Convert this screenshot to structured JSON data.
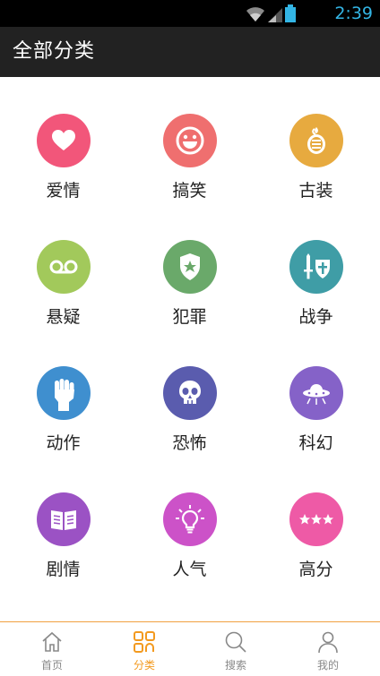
{
  "status_bar": {
    "time": "2:39",
    "wifi_icon": "wifi-icon",
    "signal_icon": "signal-icon",
    "battery_icon": "battery-icon"
  },
  "app_bar": {
    "title": "全部分类"
  },
  "categories": [
    {
      "label": "爱情",
      "icon": "heart-icon",
      "color": "#f2567a"
    },
    {
      "label": "搞笑",
      "icon": "laughing-face-icon",
      "color": "#ef6f6f"
    },
    {
      "label": "古装",
      "icon": "helmet-icon",
      "color": "#e7aa3f"
    },
    {
      "label": "悬疑",
      "icon": "voicemail-icon",
      "color": "#a2c95b"
    },
    {
      "label": "犯罪",
      "icon": "police-badge-icon",
      "color": "#6aa96a"
    },
    {
      "label": "战争",
      "icon": "sword-shield-icon",
      "color": "#3f9da6"
    },
    {
      "label": "动作",
      "icon": "fist-icon",
      "color": "#3f8fcf"
    },
    {
      "label": "恐怖",
      "icon": "skull-icon",
      "color": "#5a5cae"
    },
    {
      "label": "科幻",
      "icon": "ufo-icon",
      "color": "#8562c8"
    },
    {
      "label": "剧情",
      "icon": "book-icon",
      "color": "#9b52c4"
    },
    {
      "label": "人气",
      "icon": "lightbulb-icon",
      "color": "#cc52c8"
    },
    {
      "label": "高分",
      "icon": "stars-icon",
      "color": "#ee5aa6"
    }
  ],
  "tab_bar": {
    "tabs": [
      {
        "label": "首页",
        "icon": "home-icon"
      },
      {
        "label": "分类",
        "icon": "grid-icon",
        "active": true
      },
      {
        "label": "搜索",
        "icon": "search-icon"
      },
      {
        "label": "我的",
        "icon": "user-icon"
      }
    ],
    "active_color": "#f39a1f",
    "inactive_color": "#888888"
  }
}
